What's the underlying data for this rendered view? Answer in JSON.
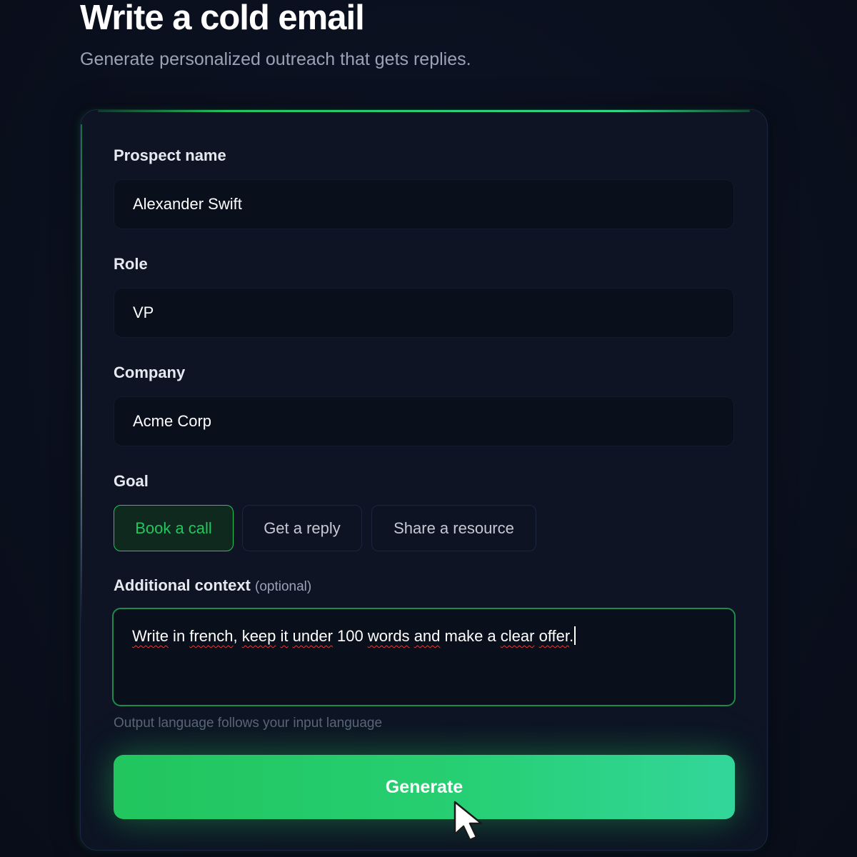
{
  "header": {
    "title": "Write a cold email",
    "subtitle": "Generate personalized outreach that gets replies."
  },
  "form": {
    "prospect_name": {
      "label": "Prospect name",
      "value": "Alexander Swift"
    },
    "role": {
      "label": "Role",
      "value": "VP"
    },
    "company": {
      "label": "Company",
      "value": "Acme Corp"
    },
    "goal": {
      "label": "Goal",
      "options": [
        "Book a call",
        "Get a reply",
        "Share a resource"
      ],
      "selected": "Book a call"
    },
    "context": {
      "label": "Additional context",
      "optional_label": "(optional)",
      "value_parts": [
        "Write",
        " in ",
        "french",
        ", ",
        "keep",
        " ",
        "it",
        " ",
        "under",
        " 100 ",
        "words",
        " ",
        "and",
        " make a ",
        "clear",
        " ",
        "offer",
        "."
      ],
      "hint": "Output language follows your input language"
    },
    "generate_label": "Generate"
  },
  "colors": {
    "accent": "#22c55e",
    "background": "#0b1020",
    "card": "#0e1424",
    "input": "#0a0f1c"
  },
  "icons": {
    "cursor": "mouse-pointer-icon"
  }
}
